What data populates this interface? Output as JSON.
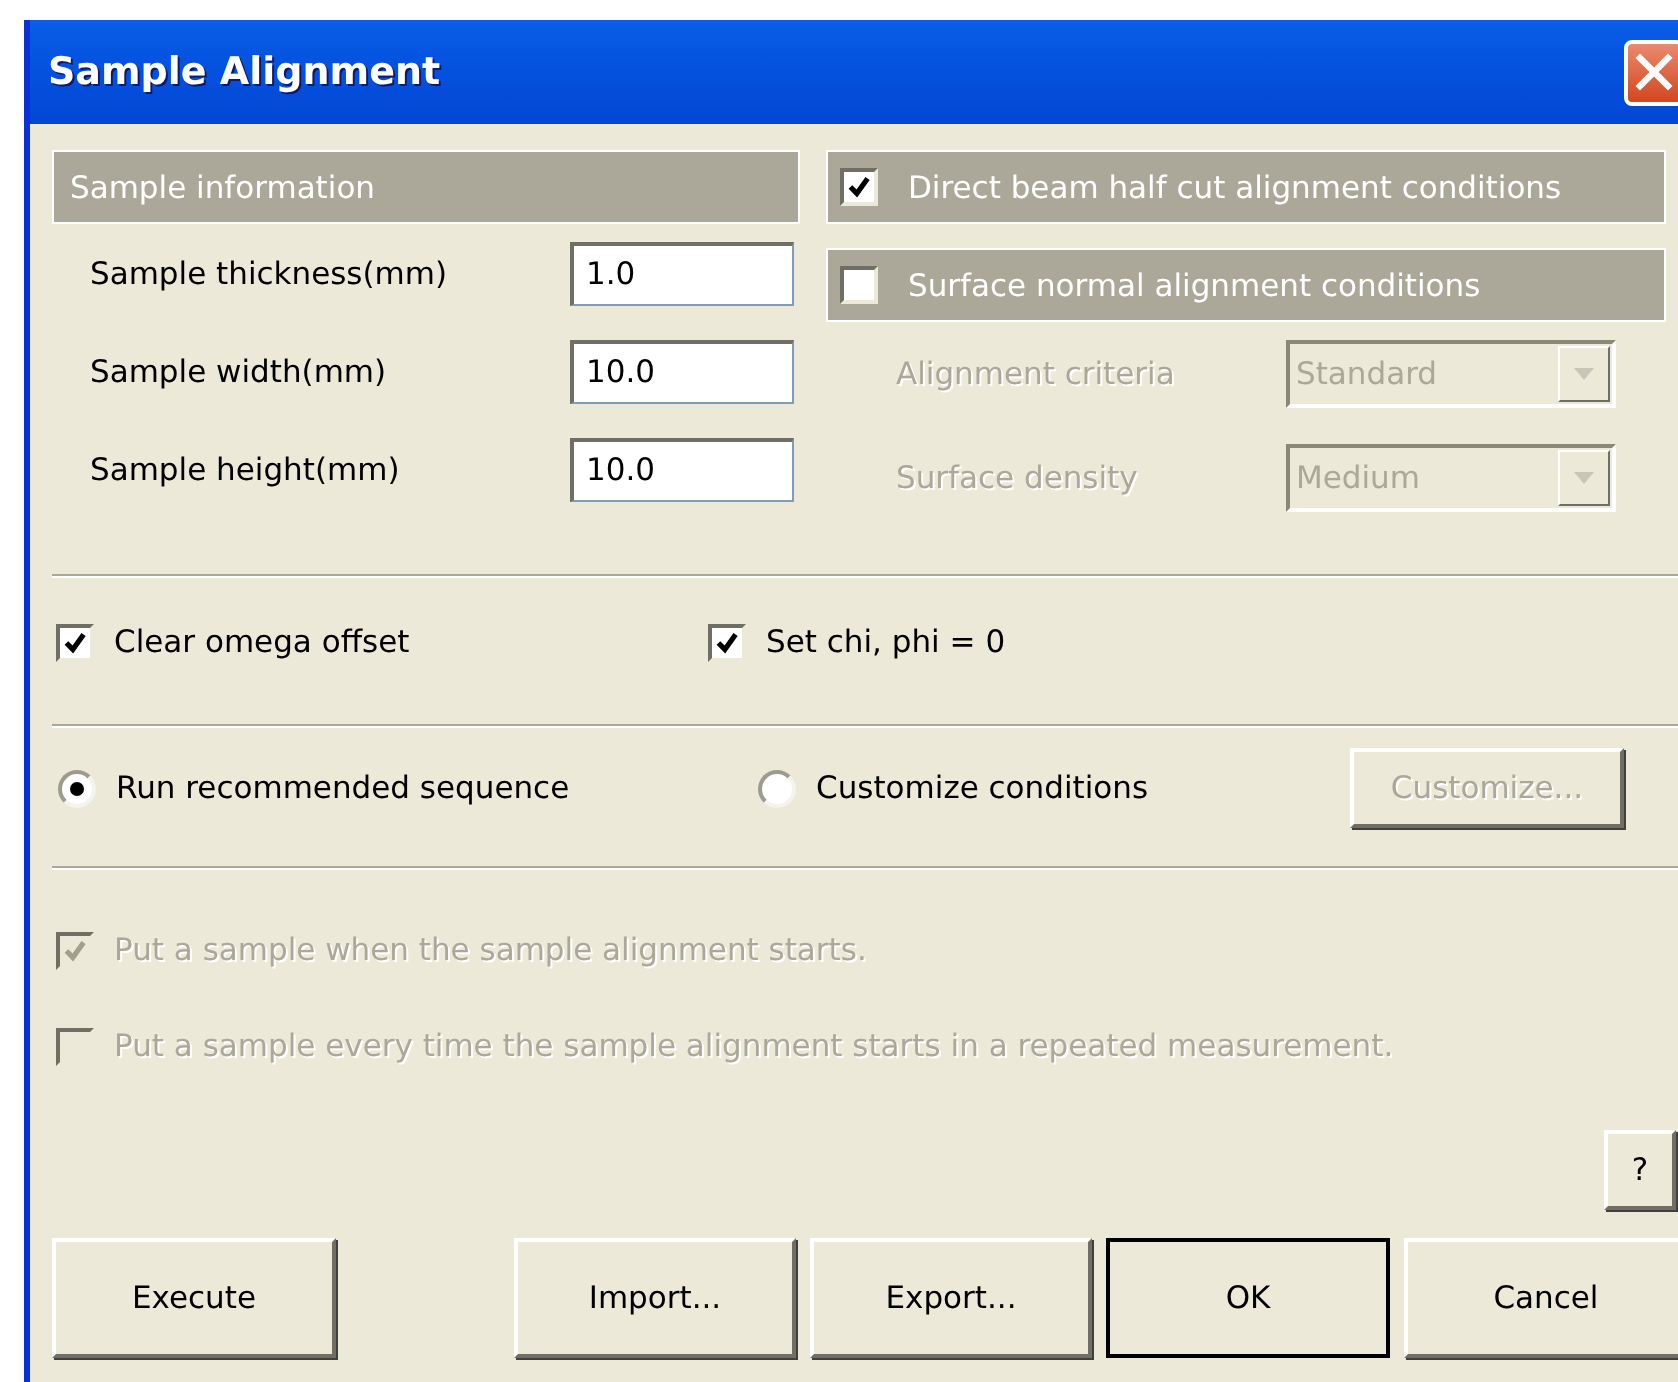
{
  "window": {
    "title": "Sample Alignment"
  },
  "sample_information": {
    "title": "Sample information",
    "fields": [
      {
        "label": "Sample thickness(mm)",
        "value": "1.0"
      },
      {
        "label": "Sample width(mm)",
        "value": "10.0"
      },
      {
        "label": "Sample height(mm)",
        "value": "10.0"
      }
    ]
  },
  "alignment_conditions": [
    {
      "label": "Direct beam half cut alignment conditions",
      "checked": true
    },
    {
      "label": "Surface normal alignment conditions",
      "checked": false
    }
  ],
  "surface_options": [
    {
      "label": "Alignment criteria",
      "value": "Standard",
      "disabled": true
    },
    {
      "label": "Surface density",
      "value": "Medium",
      "disabled": true
    }
  ],
  "options": [
    {
      "label": "Clear omega offset",
      "checked": true
    },
    {
      "label": "Set chi, phi = 0",
      "checked": true
    }
  ],
  "sequence": [
    {
      "label": "Run recommended sequence",
      "selected": true
    },
    {
      "label": "Customize conditions",
      "selected": false
    }
  ],
  "customize_button": {
    "label": "Customize...",
    "disabled": true
  },
  "sample_prompts": [
    {
      "label": "Put a sample when the sample alignment starts.",
      "checked": true,
      "disabled": true
    },
    {
      "label": "Put a sample every time the sample alignment starts in a repeated measurement.",
      "checked": false,
      "disabled": true
    }
  ],
  "help_button": {
    "label": "?"
  },
  "buttons": [
    {
      "label": "Execute",
      "default": false
    },
    {
      "label": "Import...",
      "default": false
    },
    {
      "label": "Export...",
      "default": false
    },
    {
      "label": "OK",
      "default": true
    },
    {
      "label": "Cancel",
      "default": false
    }
  ]
}
